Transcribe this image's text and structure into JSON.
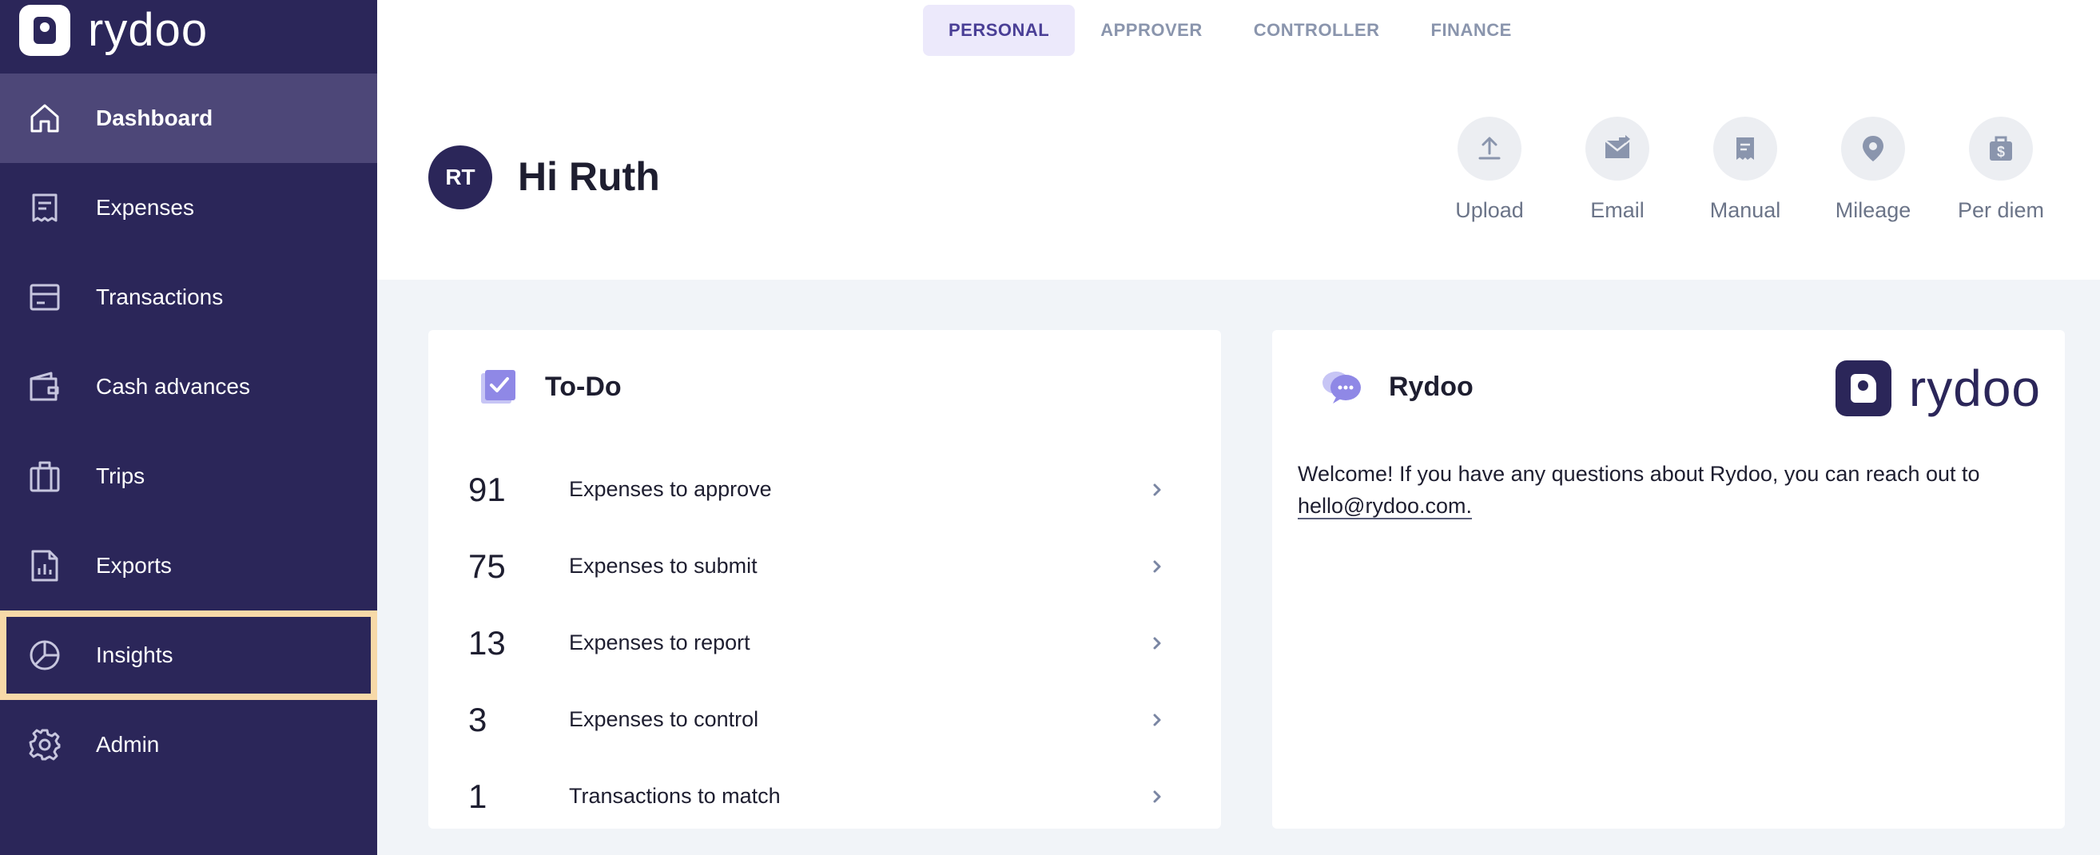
{
  "brand": {
    "name": "rydoo"
  },
  "sidebar": {
    "items": [
      {
        "label": "Dashboard",
        "icon": "home-icon",
        "active": true
      },
      {
        "label": "Expenses",
        "icon": "receipt-icon"
      },
      {
        "label": "Transactions",
        "icon": "card-icon"
      },
      {
        "label": "Cash advances",
        "icon": "wallet-icon"
      },
      {
        "label": "Trips",
        "icon": "luggage-icon"
      },
      {
        "label": "Exports",
        "icon": "report-chart-icon"
      },
      {
        "label": "Insights",
        "icon": "pie-chart-icon",
        "focused": true
      },
      {
        "label": "Admin",
        "icon": "gear-icon"
      }
    ]
  },
  "tabs": [
    {
      "label": "PERSONAL",
      "active": true
    },
    {
      "label": "APPROVER"
    },
    {
      "label": "CONTROLLER"
    },
    {
      "label": "FINANCE"
    }
  ],
  "header": {
    "avatar_initials": "RT",
    "greeting": "Hi Ruth",
    "quick_actions": [
      {
        "label": "Upload",
        "icon": "upload-icon"
      },
      {
        "label": "Email",
        "icon": "email-icon"
      },
      {
        "label": "Manual",
        "icon": "manual-receipt-icon"
      },
      {
        "label": "Mileage",
        "icon": "location-pin-icon"
      },
      {
        "label": "Per diem",
        "icon": "per-diem-bag-icon"
      }
    ]
  },
  "todo": {
    "title": "To-Do",
    "items": [
      {
        "count": "91",
        "label": "Expenses to approve"
      },
      {
        "count": "75",
        "label": "Expenses to submit"
      },
      {
        "count": "13",
        "label": "Expenses to report"
      },
      {
        "count": "3",
        "label": "Expenses to control"
      },
      {
        "count": "1",
        "label": "Transactions to match"
      }
    ]
  },
  "rydoo_card": {
    "title": "Rydoo",
    "logo_text": "rydoo",
    "welcome_text": "Welcome! If you have any questions about Rydoo, you can reach out to",
    "email": "hello@rydoo.com."
  },
  "colors": {
    "sidebar_bg": "#2b2659",
    "sidebar_active": "#4d4778",
    "focus_outline": "#f7d9a8",
    "tab_active_bg": "#ece9fb",
    "tab_active_text": "#4a3f96",
    "page_bg": "#f1f4f8"
  }
}
